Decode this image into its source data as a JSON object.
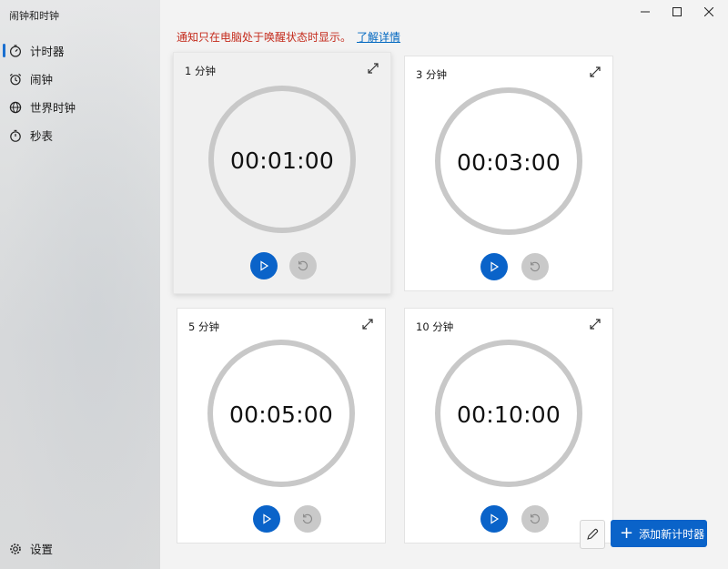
{
  "app": {
    "title": "闹钟和时钟"
  },
  "sidebar": {
    "items": [
      {
        "label": "计时器",
        "icon": "timer-icon",
        "active": true
      },
      {
        "label": "闹钟",
        "icon": "alarm-icon",
        "active": false
      },
      {
        "label": "世界时钟",
        "icon": "globe-icon",
        "active": false
      },
      {
        "label": "秒表",
        "icon": "stopwatch-icon",
        "active": false
      }
    ],
    "settings_label": "设置"
  },
  "window_controls": [
    "minimize-icon",
    "maximize-icon",
    "close-icon"
  ],
  "notice": {
    "text": "通知只在电脑处于唤醒状态时显示。",
    "link": "了解详情"
  },
  "timers": [
    {
      "title": "1 分钟",
      "time": "00:01:00"
    },
    {
      "title": "3 分钟",
      "time": "00:03:00"
    },
    {
      "title": "5 分钟",
      "time": "00:05:00"
    },
    {
      "title": "10 分钟",
      "time": "00:10:00"
    }
  ],
  "footer": {
    "add_label": "添加新计时器"
  },
  "colors": {
    "accent": "#0a63c9",
    "notice": "#c42b1c",
    "link": "#0067c0",
    "ring": "#c8c8c8"
  }
}
